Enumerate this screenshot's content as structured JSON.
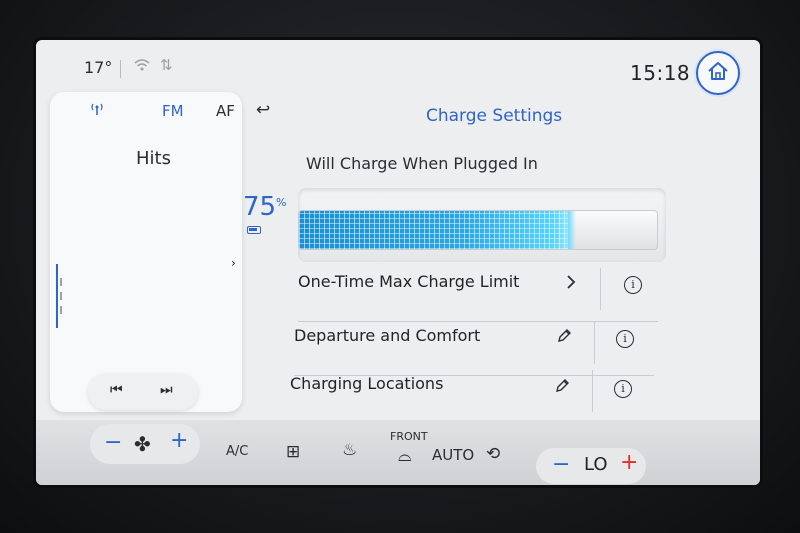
{
  "status": {
    "temperature": "17°",
    "clock": "15:18"
  },
  "radio": {
    "band": "FM",
    "af_label": "AF",
    "station": "Hits"
  },
  "charge": {
    "title": "Charge Settings",
    "status_text": "Will Charge When Plugged In",
    "battery_percent": "75",
    "percent_symbol": "%",
    "battery_level": 0.75,
    "fill_color": "#2aa6e6",
    "rows": [
      {
        "label": "One-Time Max Charge Limit",
        "action_icon": "chevron-right-icon"
      },
      {
        "label": "Departure and Comfort",
        "action_icon": "pencil-icon"
      },
      {
        "label": "Charging Locations",
        "action_icon": "pencil-icon"
      }
    ]
  },
  "climate": {
    "ac_label": "A/C",
    "front_label": "FRONT",
    "auto_label": "AUTO",
    "temp_value": "LO"
  },
  "colors": {
    "accent": "#2f64c8",
    "warm": "#d9322b"
  }
}
